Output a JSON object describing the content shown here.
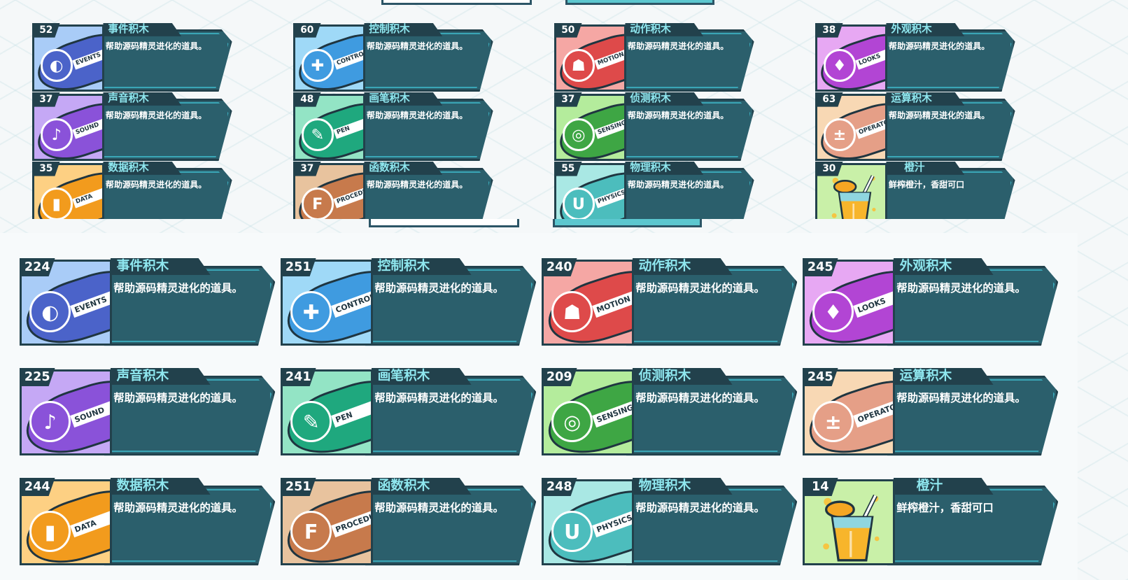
{
  "top_panel": {
    "cards": [
      {
        "count": "52",
        "name": "事件积木",
        "desc": "帮助源码精灵进化的道具。",
        "tag": "EVENTS",
        "icon": "toggle-icon",
        "glyph": "◐",
        "bg": "#a9ccf7",
        "color": "#4b63c9"
      },
      {
        "count": "60",
        "name": "控制积木",
        "desc": "帮助源码精灵进化的道具。",
        "tag": "CONTROL",
        "icon": "gamepad-icon",
        "glyph": "✚",
        "bg": "#9fd9f7",
        "color": "#3f9be0"
      },
      {
        "count": "50",
        "name": "动作积木",
        "desc": "帮助源码精灵进化的道具。",
        "tag": "MOTION",
        "icon": "ghost-icon",
        "glyph": "☗",
        "bg": "#f5a7a4",
        "color": "#de4a4a"
      },
      {
        "count": "38",
        "name": "外观积木",
        "desc": "帮助源码精灵进化的道具。",
        "tag": "LOOKS",
        "icon": "shirt-icon",
        "glyph": "♦",
        "bg": "#e7a8f3",
        "color": "#b245d4"
      },
      {
        "count": "37",
        "name": "声音积木",
        "desc": "帮助源码精灵进化的道具。",
        "tag": "SOUND",
        "icon": "microphone-icon",
        "glyph": "♪",
        "bg": "#c5a8f5",
        "color": "#8a52d9"
      },
      {
        "count": "48",
        "name": "画笔积木",
        "desc": "帮助源码精灵进化的道具。",
        "tag": "PEN",
        "icon": "pen-icon",
        "glyph": "✎",
        "bg": "#93e4c5",
        "color": "#1fa87e"
      },
      {
        "count": "37",
        "name": "侦测积木",
        "desc": "帮助源码精灵进化的道具。",
        "tag": "SENSING",
        "icon": "target-icon",
        "glyph": "◎",
        "bg": "#b4ec9c",
        "color": "#3ea644"
      },
      {
        "count": "63",
        "name": "运算积木",
        "desc": "帮助源码精灵进化的道具。",
        "tag": "OPERATOR",
        "icon": "calculator-icon",
        "glyph": "±",
        "bg": "#f8d8b4",
        "color": "#e59f87"
      },
      {
        "count": "35",
        "name": "数据积木",
        "desc": "帮助源码精灵进化的道具。",
        "tag": "DATA",
        "icon": "bar-chart-icon",
        "glyph": "▮",
        "bg": "#fdd083",
        "color": "#f29b1d"
      },
      {
        "count": "37",
        "name": "函数积木",
        "desc": "帮助源码精灵进化的道具。",
        "tag": "PROCEDURE",
        "icon": "function-icon",
        "glyph": "F",
        "bg": "#e8c39e",
        "color": "#c77a4c"
      },
      {
        "count": "55",
        "name": "物理积木",
        "desc": "帮助源码精灵进化的道具。",
        "tag": "PHYSICS",
        "icon": "magnet-icon",
        "glyph": "U",
        "bg": "#a9e8e4",
        "color": "#4cbdbd"
      },
      {
        "count": "30",
        "name": "橙汁",
        "desc": "鲜榨橙汁，香甜可口",
        "tag": "",
        "icon": "orange-juice-icon",
        "glyph": "",
        "bg": "#c9f0a8",
        "color": "#f5a623"
      }
    ]
  },
  "bottom_panel": {
    "cards": [
      {
        "count": "224",
        "name": "事件积木",
        "desc": "帮助源码精灵进化的道具。",
        "tag": "EVENTS",
        "icon": "toggle-icon",
        "glyph": "◐",
        "bg": "#a9ccf7",
        "color": "#4b63c9"
      },
      {
        "count": "251",
        "name": "控制积木",
        "desc": "帮助源码精灵进化的道具。",
        "tag": "CONTROL",
        "icon": "gamepad-icon",
        "glyph": "✚",
        "bg": "#9fd9f7",
        "color": "#3f9be0"
      },
      {
        "count": "240",
        "name": "动作积木",
        "desc": "帮助源码精灵进化的道具。",
        "tag": "MOTION",
        "icon": "ghost-icon",
        "glyph": "☗",
        "bg": "#f5a7a4",
        "color": "#de4a4a"
      },
      {
        "count": "245",
        "name": "外观积木",
        "desc": "帮助源码精灵进化的道具。",
        "tag": "LOOKS",
        "icon": "shirt-icon",
        "glyph": "♦",
        "bg": "#e7a8f3",
        "color": "#b245d4"
      },
      {
        "count": "225",
        "name": "声音积木",
        "desc": "帮助源码精灵进化的道具。",
        "tag": "SOUND",
        "icon": "microphone-icon",
        "glyph": "♪",
        "bg": "#c5a8f5",
        "color": "#8a52d9"
      },
      {
        "count": "241",
        "name": "画笔积木",
        "desc": "帮助源码精灵进化的道具。",
        "tag": "PEN",
        "icon": "pen-icon",
        "glyph": "✎",
        "bg": "#93e4c5",
        "color": "#1fa87e"
      },
      {
        "count": "209",
        "name": "侦测积木",
        "desc": "帮助源码精灵进化的道具。",
        "tag": "SENSING",
        "icon": "target-icon",
        "glyph": "◎",
        "bg": "#b4ec9c",
        "color": "#3ea644"
      },
      {
        "count": "245",
        "name": "运算积木",
        "desc": "帮助源码精灵进化的道具。",
        "tag": "OPERATOR",
        "icon": "calculator-icon",
        "glyph": "±",
        "bg": "#f8d8b4",
        "color": "#e59f87"
      },
      {
        "count": "244",
        "name": "数据积木",
        "desc": "帮助源码精灵进化的道具。",
        "tag": "DATA",
        "icon": "bar-chart-icon",
        "glyph": "▮",
        "bg": "#fdd083",
        "color": "#f29b1d"
      },
      {
        "count": "251",
        "name": "函数积木",
        "desc": "帮助源码精灵进化的道具。",
        "tag": "PROCEDURE",
        "icon": "function-icon",
        "glyph": "F",
        "bg": "#e8c39e",
        "color": "#c77a4c"
      },
      {
        "count": "248",
        "name": "物理积木",
        "desc": "帮助源码精灵进化的道具。",
        "tag": "PHYSICS",
        "icon": "magnet-icon",
        "glyph": "U",
        "bg": "#a9e8e4",
        "color": "#4cbdbd"
      },
      {
        "count": "14",
        "name": "橙汁",
        "desc": "鲜榨橙汁，香甜可口",
        "tag": "",
        "icon": "orange-juice-icon",
        "glyph": "",
        "bg": "#c9f0a8",
        "color": "#f5a623"
      }
    ]
  }
}
